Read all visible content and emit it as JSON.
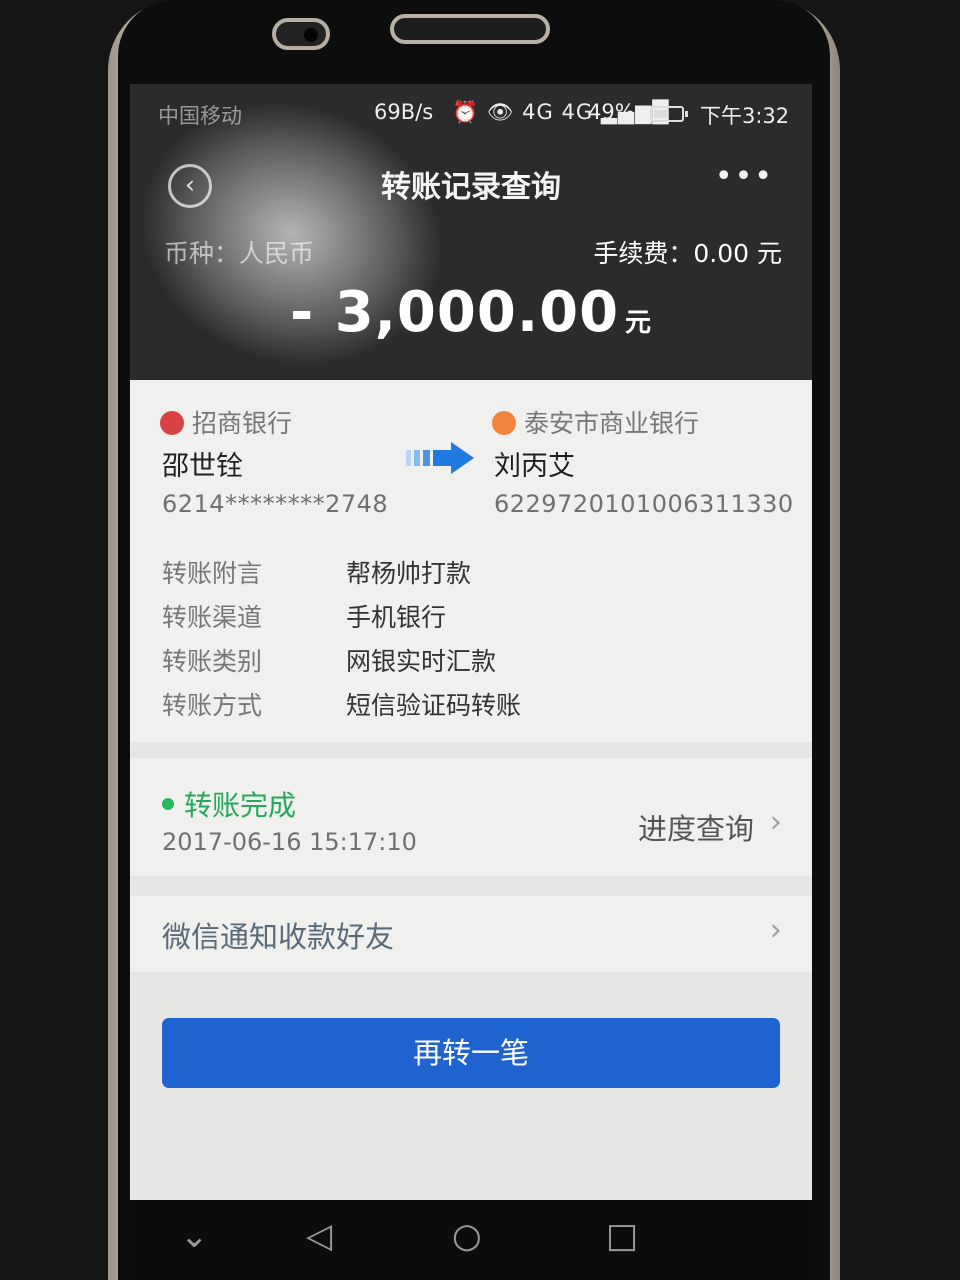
{
  "status_bar": {
    "carrier": "中国移动",
    "speed": "69B/s",
    "icons": "⏰ 👁 4G 4G ▂▄▆█",
    "battery_text": "49%",
    "battery_level": 0.49,
    "time": "下午3:32"
  },
  "navigation": {
    "back_icon": "‹",
    "title": "转账记录查询",
    "more_icon": "•••"
  },
  "summary": {
    "currency": "币种：人民币",
    "fee": "手续费：0.00 元",
    "amount": "- 3,000.00",
    "amount_unit": "元"
  },
  "transfer": {
    "from": {
      "bank": "招商银行",
      "name": "邵世铨",
      "account": "6214********2748"
    },
    "to": {
      "bank": "泰安市商业银行",
      "name": "刘丙艾",
      "account": "6229720101006311330"
    },
    "details": [
      {
        "label": "转账附言",
        "value": "帮杨帅打款"
      },
      {
        "label": "转账渠道",
        "value": "手机银行"
      },
      {
        "label": "转账类别",
        "value": "网银实时汇款"
      },
      {
        "label": "转账方式",
        "value": "短信验证码转账"
      }
    ]
  },
  "status": {
    "state": "转账完成",
    "datetime": "2017-06-16 15:17:10",
    "progress_label": "进度查询",
    "chevron": "›"
  },
  "wechat_notify": {
    "label": "微信通知收款好友",
    "chevron": "›"
  },
  "primary_action": {
    "label": "再转一笔"
  },
  "nav_keys": {
    "down": "⌄",
    "back": "◁",
    "home": "○",
    "recent": "□"
  },
  "colors": {
    "header": "#2b2b2b",
    "success": "#25a85a",
    "primary_button": "#1f63d1"
  }
}
